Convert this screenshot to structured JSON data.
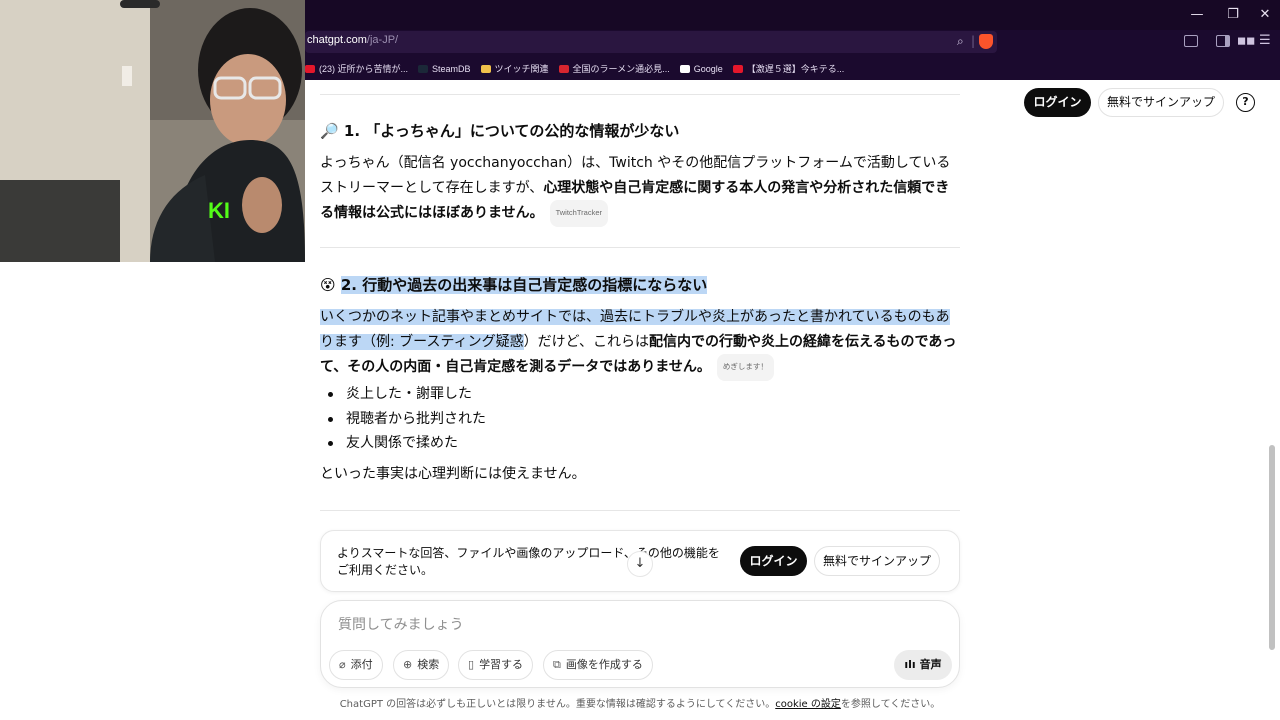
{
  "browser": {
    "url_host": "chatgpt.com",
    "url_path": "/ja-JP/",
    "bookmarks": [
      {
        "label": "(23) 近所から苦情が...",
        "color": "#e5172b"
      },
      {
        "label": "SteamDB",
        "color": "#1b2838"
      },
      {
        "label": "ツイッチ関連",
        "color": "#f0c14b"
      },
      {
        "label": "全国のラーメン通必見...",
        "color": "#d8262f"
      },
      {
        "label": "Google",
        "color": "#ffffff"
      },
      {
        "label": "【激遅５選】今キテる...",
        "color": "#e5172b"
      }
    ]
  },
  "header": {
    "login": "ログイン",
    "signup": "無料でサインアップ",
    "help": "?"
  },
  "content": {
    "section1": {
      "emoji": "🔎",
      "title": "1. 「よっちゃん」についての公的な情報が少ない",
      "para_plain": "よっちゃん（配信名 yocchanyocchan）は、Twitch やその他配信プラットフォームで活動しているストリーマーとして存在しますが、",
      "para_bold": "心理状態や自己肯定感に関する本人の発言や分析された信頼できる情報は公式にはほぼありません。",
      "cite": "TwitchTracker"
    },
    "section2": {
      "emoji": "😵",
      "title": "2. 行動や過去の出来事は自己肯定感の指標にならない",
      "para_hl1": "いくつかのネット記事やまとめサイトでは、過去にトラブルや炎上があったと書かれているものもあります",
      "para_hl2": "（例: ブースティング疑惑",
      "para_plain": "）だけど、これらは",
      "para_bold": "配信内での行動や炎上の経緯を伝えるものであって、その人の内面・自己肯定感を測るデータではありません。",
      "cite": "めぎします！",
      "bullets": [
        "炎上した・謝罪した",
        "視聴者から批判された",
        "友人関係で揉めた"
      ],
      "conclusion": "といった事実は心理判断には使えません。"
    }
  },
  "promo": {
    "text": "よりスマートな回答、ファイルや画像のアップロード、その他の機能をご利用ください。",
    "login": "ログイン",
    "signup": "無料でサインアップ"
  },
  "composer": {
    "placeholder": "質問してみましょう",
    "buttons": [
      "添付",
      "検索",
      "学習する",
      "画像を作成する"
    ],
    "voice": "音声"
  },
  "footer": {
    "text_before": "ChatGPT の回答は必ずしも正しいとは限りません。重要な情報は確認するようにしてください。",
    "link": "cookie の設定",
    "text_after": "を参照してください。"
  }
}
